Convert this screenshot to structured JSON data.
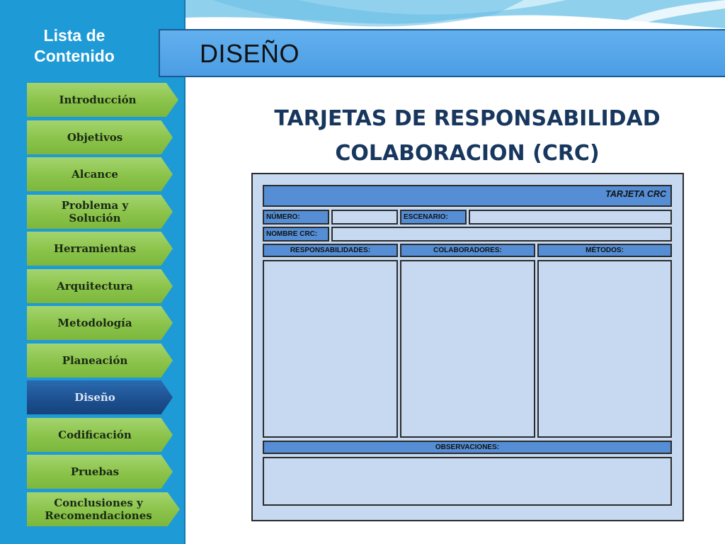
{
  "sidebar": {
    "title_line1": "Lista  de",
    "title_line2": "Contenido",
    "items": [
      {
        "label": "Introducción",
        "active": false
      },
      {
        "label": "Objetivos",
        "active": false
      },
      {
        "label": "Alcance",
        "active": false
      },
      {
        "label": "Problema y Solución",
        "active": false
      },
      {
        "label": "Herramientas",
        "active": false
      },
      {
        "label": "Arquitectura",
        "active": false
      },
      {
        "label": "Metodología",
        "active": false
      },
      {
        "label": "Planeación",
        "active": false
      },
      {
        "label": "Diseño",
        "active": true
      },
      {
        "label": "Codificación",
        "active": false
      },
      {
        "label": "Pruebas",
        "active": false
      },
      {
        "label": "Conclusiones y Recomendaciones",
        "active": false
      }
    ]
  },
  "header": {
    "title": "DISEÑO"
  },
  "main": {
    "title_line1": "TARJETAS DE RESPONSABILIDAD",
    "title_line2": "COLABORACION (CRC)"
  },
  "crc": {
    "title": "TARJETA CRC",
    "numero": "NÚMERO:",
    "escenario": "ESCENARIO:",
    "nombre": "NOMBRE CRC:",
    "responsabilidades": "RESPONSABILIDADES:",
    "colaboradores": "COLABORADORES:",
    "metodos": "MÉTODOS:",
    "observaciones": "OBSERVACIONES:"
  },
  "colors": {
    "sidebar": "#1e9ad6",
    "nav_item": "#8bc34a",
    "nav_active": "#1c4f8e",
    "header": "#4c9de4",
    "title": "#17375e",
    "card": "#c6d9f0",
    "card_header": "#558ed5"
  }
}
